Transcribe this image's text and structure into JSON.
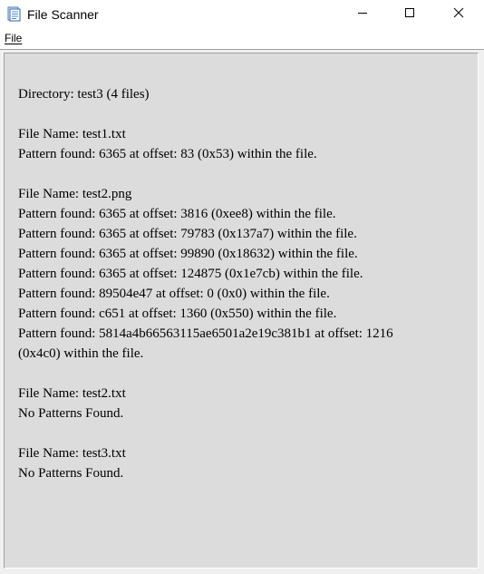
{
  "window": {
    "title": "File Scanner",
    "icon": "file-scanner-app-icon",
    "controls": {
      "minimize_icon": "minimize-icon",
      "maximize_icon": "maximize-icon",
      "close_icon": "close-icon"
    }
  },
  "menubar": {
    "items": [
      {
        "label": "File"
      }
    ]
  },
  "output": {
    "lines": [
      "Directory: test3 (4 files)",
      "",
      "File Name: test1.txt",
      "Pattern found: 6365 at offset: 83 (0x53) within the file.",
      "",
      "File Name: test2.png",
      "Pattern found: 6365 at offset: 3816 (0xee8) within the file.",
      "Pattern found: 6365 at offset: 79783 (0x137a7) within the file.",
      "Pattern found: 6365 at offset: 99890 (0x18632) within the file.",
      "Pattern found: 6365 at offset: 124875 (0x1e7cb) within the file.",
      "Pattern found: 89504e47 at offset: 0 (0x0) within the file.",
      "Pattern found: c651 at offset: 1360 (0x550) within the file.",
      "Pattern found: 5814a4b66563115ae6501a2e19c381b1 at offset: 1216",
      "(0x4c0) within the file.",
      "",
      "File Name: test2.txt",
      "No Patterns Found.",
      "",
      "File Name: test3.txt",
      "No Patterns Found."
    ]
  },
  "colors": {
    "output_background": "#dcdcdc",
    "window_background": "#ffffff"
  }
}
